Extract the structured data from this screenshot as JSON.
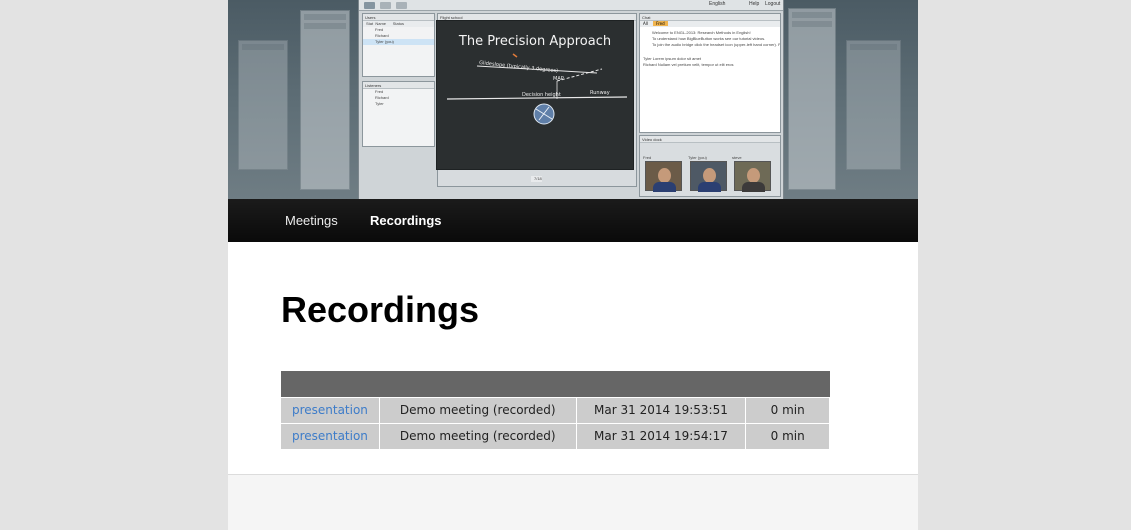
{
  "banner": {
    "toolbar": {
      "language": "English",
      "help": "Help",
      "logout": "Logout"
    },
    "users_panel": {
      "title": "Users",
      "columns": [
        "Stat",
        "Name",
        "Status"
      ],
      "users": [
        "Fred",
        "Richard",
        "Tyler (you)"
      ]
    },
    "listeners_panel": {
      "title": "Listeners",
      "users": [
        "Fred",
        "Richard",
        "Tyler"
      ]
    },
    "presentation": {
      "window_title": "Flight school",
      "slide_title": "The Precision Approach",
      "labels": [
        "Glideslope (typically 3 degrees)",
        "MAP",
        "Decision height",
        "Runway"
      ],
      "page": "7/18"
    },
    "chat_panel": {
      "title": "Chat",
      "tabs": [
        "All",
        "Fred"
      ],
      "messages": [
        "Welcome to ENGL-2013: Research Methods in English!",
        "To understand how BigBlueButton works see our tutorial videos.",
        "To join the audio bridge click the headset icon (upper-left hand corner). Please use a headset to avoid causing echo for others.",
        "Tyler  Lorem ipsum dolor sit amet",
        "Richard  Nullam vel pretium velit, tempor ut elit eros"
      ]
    },
    "video_panel": {
      "title": "Video dock",
      "names": [
        "Fred",
        "Tyler (you)",
        "steve"
      ]
    }
  },
  "nav": {
    "meetings": "Meetings",
    "recordings": "Recordings"
  },
  "page_title": "Recordings",
  "recordings": [
    {
      "playback": "presentation",
      "name": "Demo meeting (recorded)",
      "date": "Mar 31 2014 19:53:51",
      "length": "0 min"
    },
    {
      "playback": "presentation",
      "name": "Demo meeting (recorded)",
      "date": "Mar 31 2014 19:54:17",
      "length": "0 min"
    }
  ]
}
